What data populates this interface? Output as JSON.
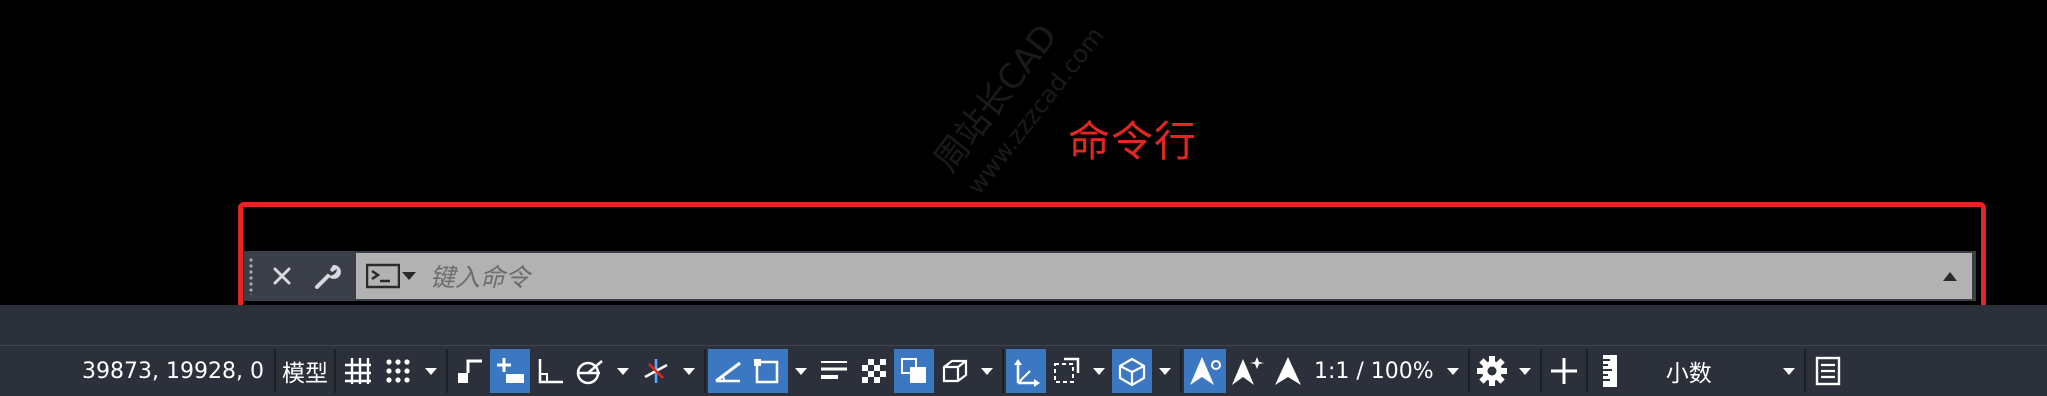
{
  "annotation": {
    "label": "命令行"
  },
  "watermark": {
    "line1": "周站长CAD",
    "line2": "www.zzzcad.com"
  },
  "command_line": {
    "placeholder": "键入命令"
  },
  "status_bar": {
    "coordinates": "39873, 19928, 0",
    "model_tab": "模型",
    "annotation_scale": "1:1 / 100%",
    "units": "小数"
  },
  "colors": {
    "annotation_red": "#e3261f",
    "active_button": "#3c78c2",
    "status_bar_bg": "#2b303a",
    "command_input_bg": "#b2b2b2"
  },
  "icons": [
    "close-icon",
    "wrench-icon",
    "command-prompt-icon",
    "chevron-down-icon",
    "scroll-up-icon",
    "grid-icon",
    "snap-dots-icon",
    "infer-constraints-icon",
    "dynamic-input-icon",
    "ortho-icon",
    "polar-tracking-icon",
    "isometric-icon",
    "object-snap-tracking-icon",
    "object-snap-icon",
    "lineweight-icon",
    "transparency-icon",
    "selection-cycling-icon",
    "3d-object-snap-icon",
    "dynamic-ucs-icon",
    "selection-filter-icon",
    "gizmo-icon",
    "annotation-visibility-icon",
    "auto-scale-icon",
    "annotation-scale-icon",
    "gear-icon",
    "plus-icon",
    "units-ruler-icon",
    "quick-properties-icon"
  ]
}
